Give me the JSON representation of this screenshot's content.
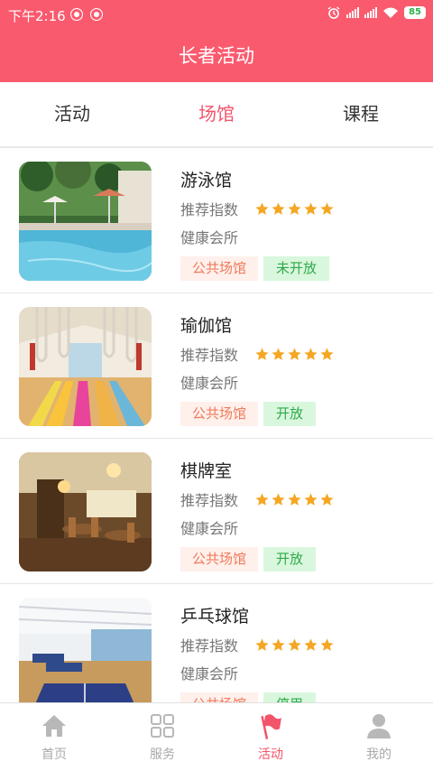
{
  "status": {
    "time": "下午2:16",
    "battery": "85"
  },
  "header": {
    "title": "长者活动"
  },
  "tabs": [
    {
      "label": "活动",
      "active": false
    },
    {
      "label": "场馆",
      "active": true
    },
    {
      "label": "课程",
      "active": false
    }
  ],
  "venues": [
    {
      "name": "游泳馆",
      "rating_label": "推荐指数",
      "stars": 5,
      "category": "健康会所",
      "tag_type": "公共场馆",
      "tag_status": "未开放",
      "image": "pool"
    },
    {
      "name": "瑜伽馆",
      "rating_label": "推荐指数",
      "stars": 5,
      "category": "健康会所",
      "tag_type": "公共场馆",
      "tag_status": "开放",
      "image": "yoga"
    },
    {
      "name": "棋牌室",
      "rating_label": "推荐指数",
      "stars": 5,
      "category": "健康会所",
      "tag_type": "公共场馆",
      "tag_status": "开放",
      "image": "cards"
    },
    {
      "name": "乒乓球馆",
      "rating_label": "推荐指数",
      "stars": 5,
      "category": "健康会所",
      "tag_type": "公共场馆",
      "tag_status": "停用",
      "image": "pingpong"
    }
  ],
  "navbar": [
    {
      "label": "首页",
      "icon": "home-icon",
      "active": false
    },
    {
      "label": "服务",
      "icon": "grid-icon",
      "active": false
    },
    {
      "label": "活动",
      "icon": "flag-icon",
      "active": true
    },
    {
      "label": "我的",
      "icon": "person-icon",
      "active": false
    }
  ],
  "colors": {
    "primary": "#fa5a6e",
    "active_text": "#f2546b",
    "star": "#f5a623",
    "tag_type_bg": "#fff0ec",
    "tag_status_bg": "#d9f7dd"
  }
}
